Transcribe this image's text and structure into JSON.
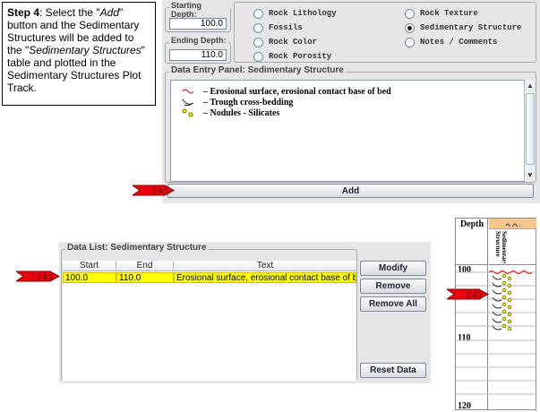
{
  "callout": {
    "step": "Step 4",
    "text_parts": [
      ": Select the \"",
      "Add",
      "\" button and the Sedimentary Structures will be added to the \"",
      "Sedimentary Structures",
      "\" table and plotted in the Sedimentary Structures Plot Track."
    ]
  },
  "depth": {
    "starting_label": "Starting Depth:",
    "starting_value": "100.0",
    "ending_label": "Ending Depth:",
    "ending_value": "110.0"
  },
  "radios": [
    {
      "label": "Rock Lithology",
      "selected": false
    },
    {
      "label": "Fossils",
      "selected": false
    },
    {
      "label": "Rock Color",
      "selected": false
    },
    {
      "label": "Rock Porosity",
      "selected": false
    },
    {
      "label": "Rock Texture",
      "selected": false
    },
    {
      "label": "Sedimentary Structure",
      "selected": true
    },
    {
      "label": "Notes / Comments",
      "selected": false
    }
  ],
  "entry_panel": {
    "title": "Data Entry Panel: Sedimentary Structure",
    "items": [
      {
        "text": "– Erosional surface, erosional contact base of bed",
        "icon": "erosional-surface-icon"
      },
      {
        "text": "– Trough cross-bedding",
        "icon": "trough-cross-bedding-icon"
      },
      {
        "text": "– Nodules - Silicates",
        "icon": "nodules-icon"
      }
    ],
    "add_label": "Add"
  },
  "marker": "( 4 )",
  "data_list": {
    "title": "Data List: Sedimentary Structure",
    "columns": [
      "Start",
      "End",
      "Text"
    ],
    "rows": [
      {
        "start": "100.0",
        "end": "110.0",
        "text": "Erosional surface, erosional contact base of b..."
      }
    ],
    "buttons": {
      "modify": "Modify",
      "remove": "Remove",
      "remove_all": "Remove All",
      "reset": "Reset Data"
    }
  },
  "plot_track": {
    "depth_header": "Depth",
    "track_title": "Sedimentary Structure",
    "depth_labels": [
      "100",
      "110",
      "120"
    ]
  },
  "colors": {
    "highlight": "#ffff00",
    "arrow": "#e8000c",
    "header_orange": "#f5c78a",
    "panel": "#e6e6e6"
  }
}
